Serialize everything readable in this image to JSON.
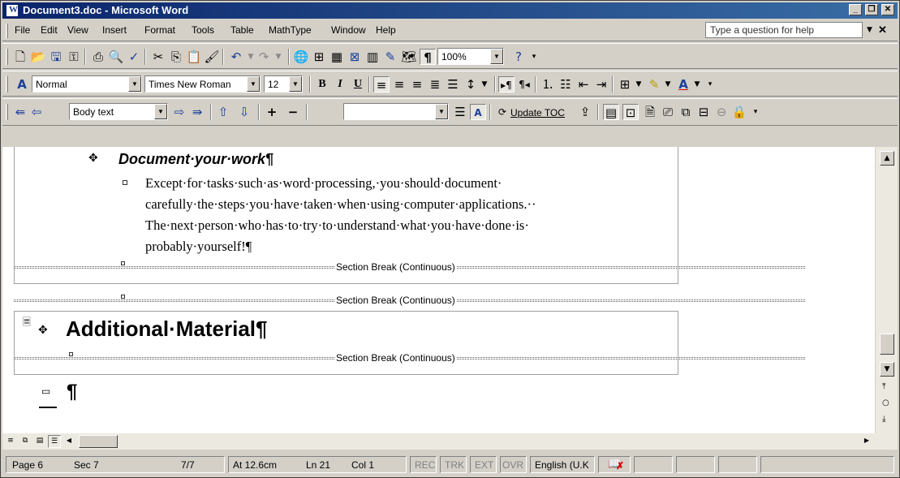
{
  "window": {
    "title": "Document3.doc - Microsoft Word"
  },
  "menu": {
    "items": [
      "File",
      "Edit",
      "View",
      "Insert",
      "Format",
      "Tools",
      "Table",
      "MathType",
      "Window",
      "Help"
    ],
    "help_placeholder": "Type a question for help"
  },
  "standard_toolbar": {
    "zoom": "100%"
  },
  "formatting_toolbar": {
    "style": "Normal",
    "font": "Times New Roman",
    "size": "12"
  },
  "outlining_toolbar": {
    "level": "Body text",
    "update_toc_label": "Update TOC"
  },
  "document": {
    "heading2": "Document·your·work¶",
    "body_lines": [
      "Except·for·tasks·such·as·word·processing,·you·should·document·",
      "carefully·the·steps·you·have·taken·when·using·computer·applications.··",
      "The·next·person·who·has·to·try·to·understand·what·you·have·done·is·",
      "probably·yourself!¶"
    ],
    "section_break": "Section Break (Continuous)",
    "heading1": "Additional·Material¶",
    "final_mark": "¶"
  },
  "status": {
    "page": "Page 6",
    "sec": "Sec 7",
    "pages": "7/7",
    "at": "At 12.6cm",
    "ln": "Ln 21",
    "col": "Col 1",
    "rec": "REC",
    "trk": "TRK",
    "ext": "EXT",
    "ovr": "OVR",
    "language": "English (U.K"
  }
}
